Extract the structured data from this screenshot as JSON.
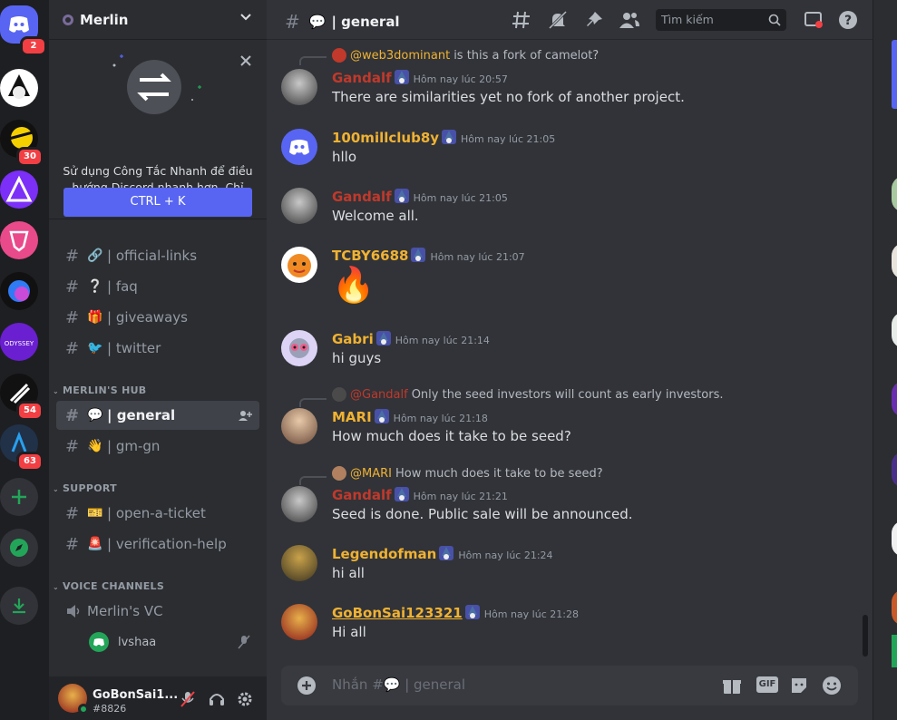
{
  "server": {
    "name": "Merlin"
  },
  "quick_switcher": {
    "description": "Sử dụng Công Tắc Nhanh để điều hướng Discord nhanh hơn. Chỉ cần nhấn:",
    "shortcut": "CTRL + K"
  },
  "rail": {
    "badges": [
      "2",
      "30",
      "54",
      "63"
    ]
  },
  "channels": [
    {
      "emoji": "🔗",
      "label": "| official-links"
    },
    {
      "emoji": "❔",
      "label": "| faq"
    },
    {
      "emoji": "🎁",
      "label": "| giveaways"
    },
    {
      "emoji": "🐦",
      "label": "| twitter"
    }
  ],
  "categories": {
    "hub": "MERLIN'S HUB",
    "support": "SUPPORT",
    "voice": "VOICE CHANNELS"
  },
  "hub_channels": [
    {
      "emoji": "💬",
      "label": "| general",
      "active": true
    },
    {
      "emoji": "👋",
      "label": "| gm-gn",
      "active": false
    }
  ],
  "support_channels": [
    {
      "emoji": "🎫",
      "label": "| open-a-ticket"
    },
    {
      "emoji": "🚨",
      "label": "| verification-help"
    }
  ],
  "voice": {
    "channel": "Merlin's VC",
    "member": "lvshaa"
  },
  "user": {
    "name": "GoBonSai1...",
    "tag": "#8826"
  },
  "header": {
    "channel": "| general",
    "search_placeholder": "Tìm kiếm"
  },
  "messages": [
    {
      "reply_to": "@web3dominant",
      "reply_text": "is this a fork of camelot?",
      "author": "Gandalf",
      "color": "#c0392b",
      "time": "Hôm nay lúc 20:57",
      "text": "There are similarities yet no fork of another project."
    },
    {
      "author": "100millclub8y",
      "color": "#f0b232",
      "time": "Hôm nay lúc 21:05",
      "text": "hllo"
    },
    {
      "author": "Gandalf",
      "color": "#c0392b",
      "time": "Hôm nay lúc 21:05",
      "text": "Welcome all."
    },
    {
      "author": "TCBY6688",
      "color": "#f0b232",
      "time": "Hôm nay lúc 21:07",
      "text": "🔥"
    },
    {
      "author": "Gabri",
      "color": "#f0b232",
      "time": "Hôm nay lúc 21:14",
      "text": "hi guys"
    },
    {
      "reply_to": "@Gandalf",
      "reply_text": "Only the seed investors will count as early investors.",
      "author": "MARI",
      "color": "#f0b232",
      "time": "Hôm nay lúc 21:18",
      "text": "How much does it take to be seed?"
    },
    {
      "reply_to": "@MARI",
      "reply_text": "How much does it take to be seed?",
      "author": "Gandalf",
      "color": "#c0392b",
      "time": "Hôm nay lúc 21:21",
      "text": "Seed is done. Public sale will be announced."
    },
    {
      "author": "Legendofman",
      "color": "#f0b232",
      "time": "Hôm nay lúc 21:24",
      "text": "hi all"
    },
    {
      "author": "GoBonSai123321",
      "color": "#f0b232",
      "time": "Hôm nay lúc 21:28",
      "text": "Hi all"
    }
  ],
  "composer": {
    "placeholder": "Nhắn #💬 | general"
  }
}
